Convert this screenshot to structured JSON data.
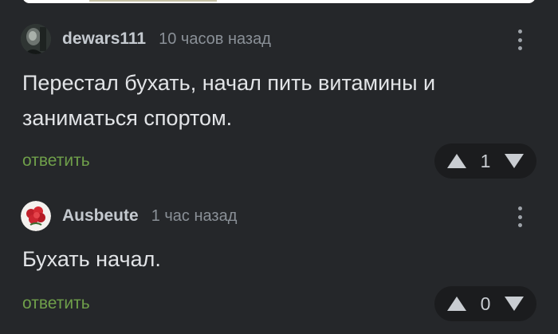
{
  "comments": [
    {
      "username": "dewars111",
      "time": "10 часов назад",
      "text": "Перестал бухать, начал пить витамины и заниматься спортом.",
      "reply_label": "ответить",
      "rating": "1"
    },
    {
      "username": "Ausbeute",
      "time": "1 час назад",
      "text": "Бухать начал.",
      "reply_label": "ответить",
      "rating": "0"
    }
  ],
  "icons": {
    "more": "more-vertical-icon",
    "upvote": "triangle-up-icon",
    "downvote": "triangle-down-icon"
  },
  "colors": {
    "background": "#25272a",
    "reply": "#6f9f4a",
    "vote_pill": "#1b1c1e"
  }
}
